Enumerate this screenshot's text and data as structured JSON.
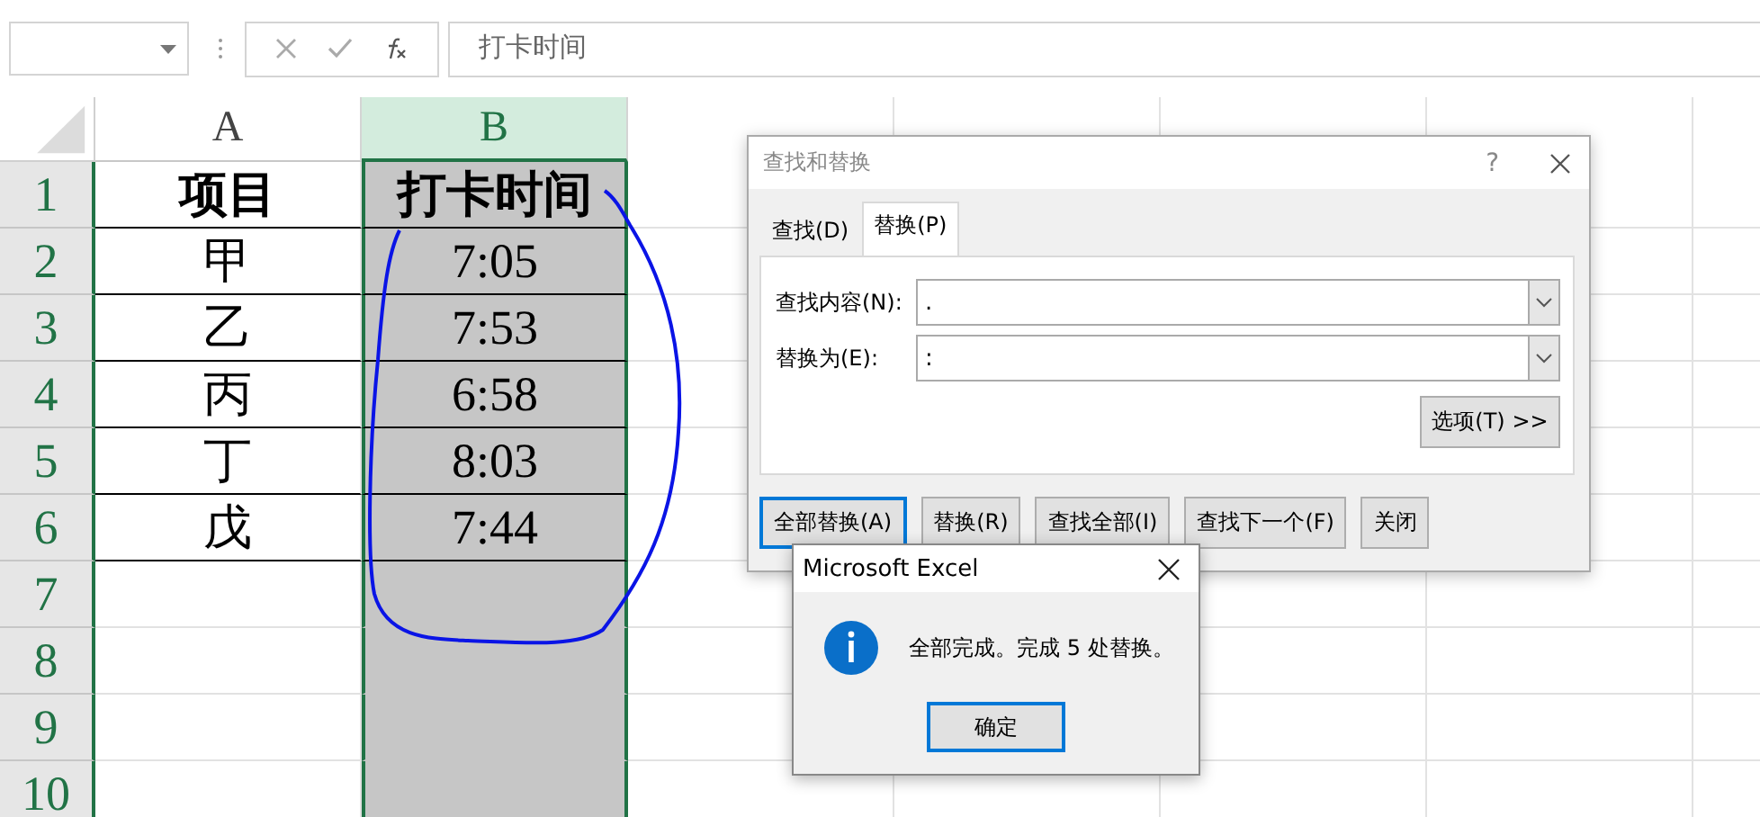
{
  "formula_bar": {
    "formula": "打卡时间"
  },
  "sheet": {
    "columns": [
      {
        "label": "A",
        "selected": false
      },
      {
        "label": "B",
        "selected": true
      }
    ],
    "rows": [
      {
        "number": "1",
        "cells": [
          "项目",
          "打卡时间"
        ]
      },
      {
        "number": "2",
        "cells": [
          "甲",
          "7:05"
        ]
      },
      {
        "number": "3",
        "cells": [
          "乙",
          "7:53"
        ]
      },
      {
        "number": "4",
        "cells": [
          "丙",
          "6:58"
        ]
      },
      {
        "number": "5",
        "cells": [
          "丁",
          "8:03"
        ]
      },
      {
        "number": "6",
        "cells": [
          "戊",
          "7:44"
        ]
      },
      {
        "number": "7",
        "cells": []
      },
      {
        "number": "8",
        "cells": []
      },
      {
        "number": "9",
        "cells": []
      },
      {
        "number": "10",
        "cells": []
      }
    ]
  },
  "find_replace_dialog": {
    "title": "查找和替换",
    "help": "?",
    "tabs": [
      {
        "label": "查找(D)",
        "selected": false
      },
      {
        "label": "替换(P)",
        "selected": true
      }
    ],
    "fields": [
      {
        "label": "查找内容(N):",
        "value": "."
      },
      {
        "label": "替换为(E):",
        "value": ":"
      }
    ],
    "options_button": {
      "label": "选项(T)",
      "suffix": ">>"
    },
    "buttons": [
      {
        "label": "全部替换(A)",
        "focused": true
      },
      {
        "label": "替换(R)",
        "focused": false
      },
      {
        "label": "查找全部(I)",
        "focused": false
      },
      {
        "label": "查找下一个(F)",
        "focused": false
      },
      {
        "label": "关闭",
        "focused": false
      }
    ]
  },
  "message_box": {
    "title": "Microsoft Excel",
    "message": "全部完成。完成 5 处替换。",
    "button": "确定"
  }
}
